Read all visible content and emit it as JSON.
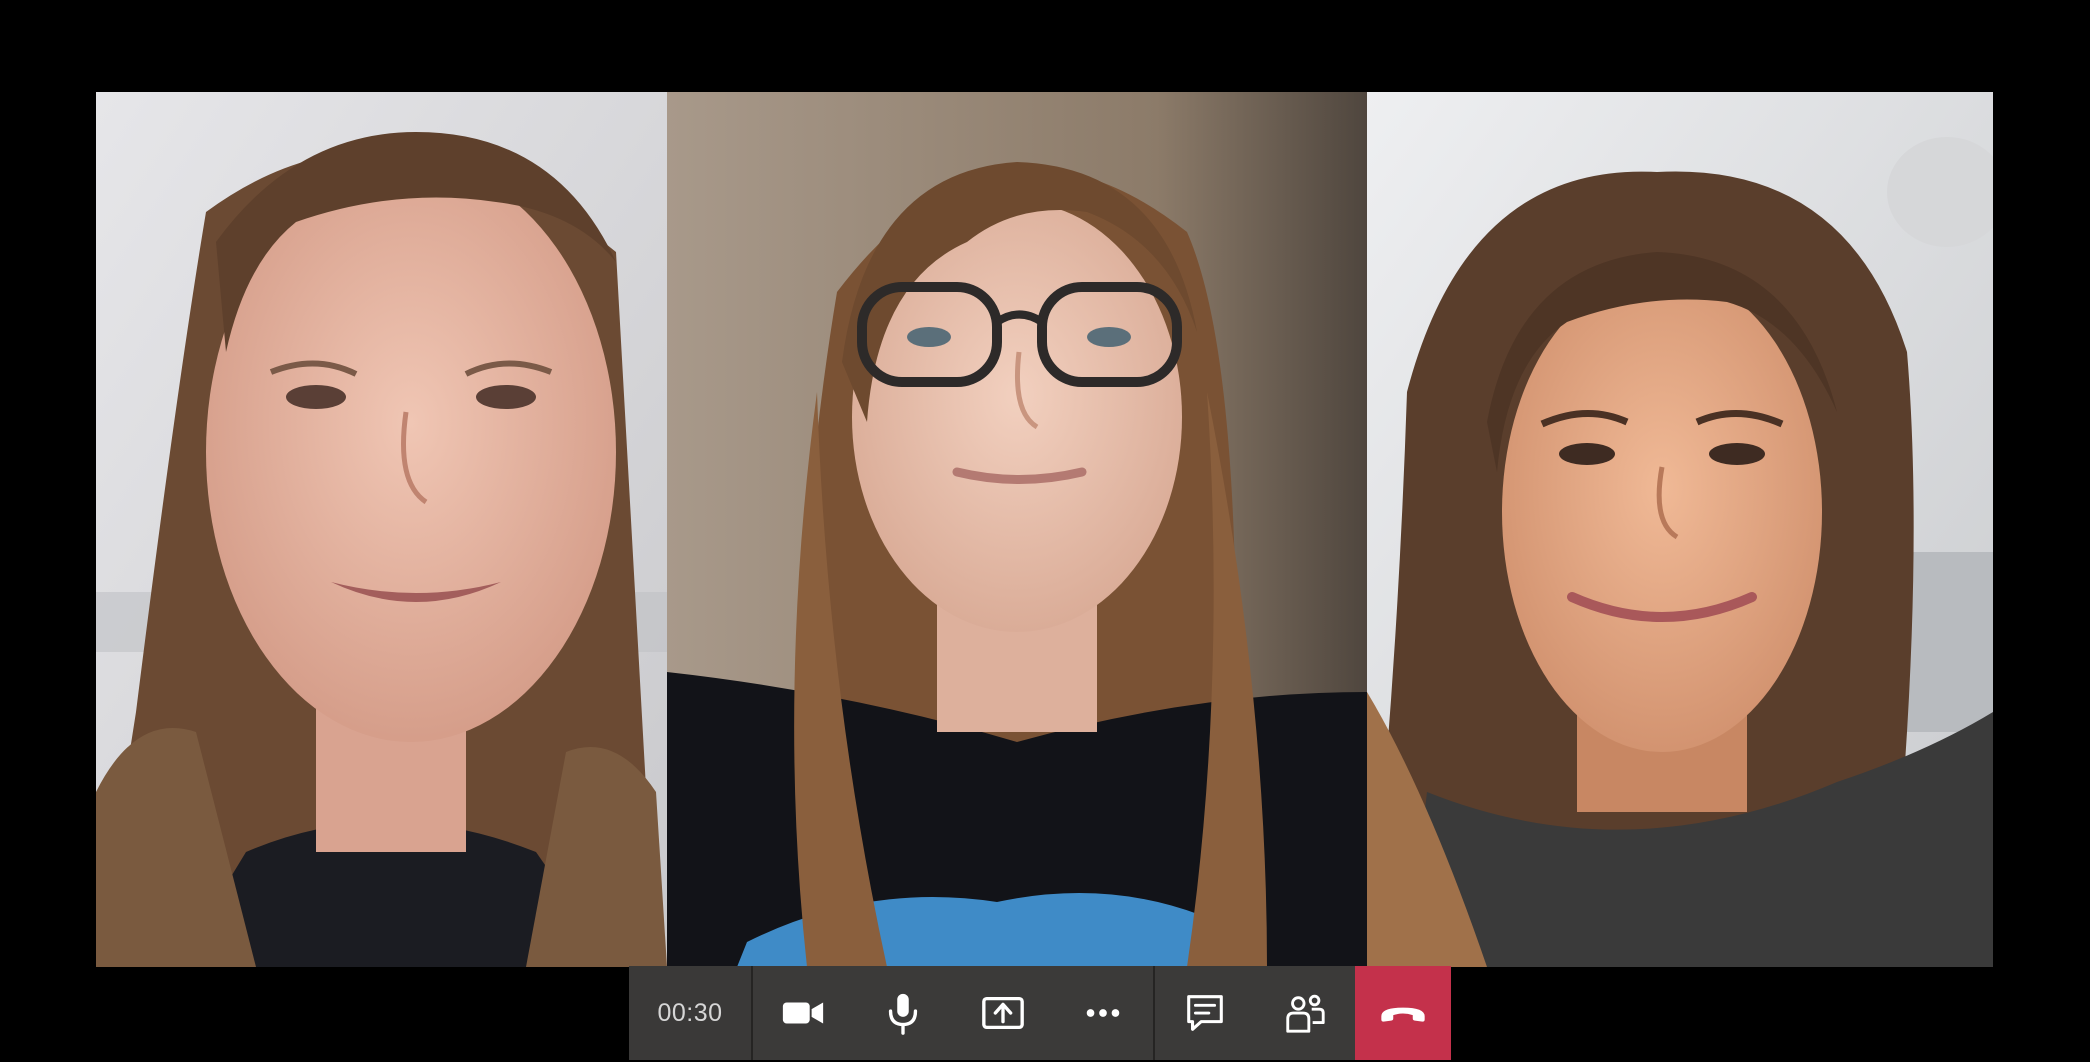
{
  "call": {
    "timer": "00:30"
  },
  "participants": [
    {
      "tile": "left",
      "hair": "#6b4a33",
      "skin": "#e4b49f",
      "shirt": "#1b1c22",
      "background": "#d9d9db"
    },
    {
      "tile": "center",
      "hair": "#7a5234",
      "skin": "#e9c2ad",
      "shirt": "#121318",
      "background": "#8b7a68"
    },
    {
      "tile": "right",
      "hair": "#5a3e2c",
      "skin": "#e3a886",
      "shirt": "#3a3a3a",
      "background": "#e3e4e6"
    }
  ],
  "toolbar": {
    "buttons": [
      {
        "icon": "camera-icon"
      },
      {
        "icon": "microphone-icon"
      },
      {
        "icon": "share-screen-icon"
      },
      {
        "icon": "more-options-icon"
      },
      {
        "icon": "chat-icon"
      },
      {
        "icon": "participants-icon"
      },
      {
        "icon": "hang-up-icon"
      }
    ]
  },
  "colors": {
    "toolbar_bg": "#3b3a39",
    "hangup_bg": "#c4314b",
    "icon": "#ffffff",
    "timer_text": "#d6d6d6"
  }
}
